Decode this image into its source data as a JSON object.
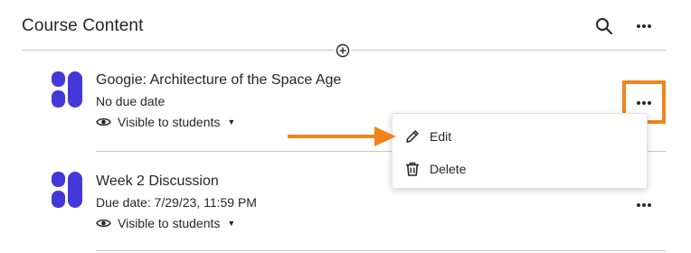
{
  "header": {
    "title": "Course Content"
  },
  "items": [
    {
      "title": "Googie: Architecture of the Space Age",
      "due": "No due date",
      "visibility": "Visible to students"
    },
    {
      "title": "Week 2 Discussion",
      "due": "Due date: 7/29/23, 11:59 PM",
      "visibility": "Visible to students"
    }
  ],
  "menu": {
    "edit": "Edit",
    "delete": "Delete"
  },
  "colors": {
    "accent_orange": "#f0851c",
    "item_icon_purple": "#4339d8",
    "text": "#262626",
    "divider": "#c7c7c7"
  },
  "icons": {
    "search": "search-icon",
    "more": "more-horizontal-icon",
    "add": "plus-circle-icon",
    "visibility": "eye-icon",
    "caret": "caret-down-icon",
    "edit": "pencil-icon",
    "delete": "trash-icon",
    "item": "learning-module-icon"
  }
}
